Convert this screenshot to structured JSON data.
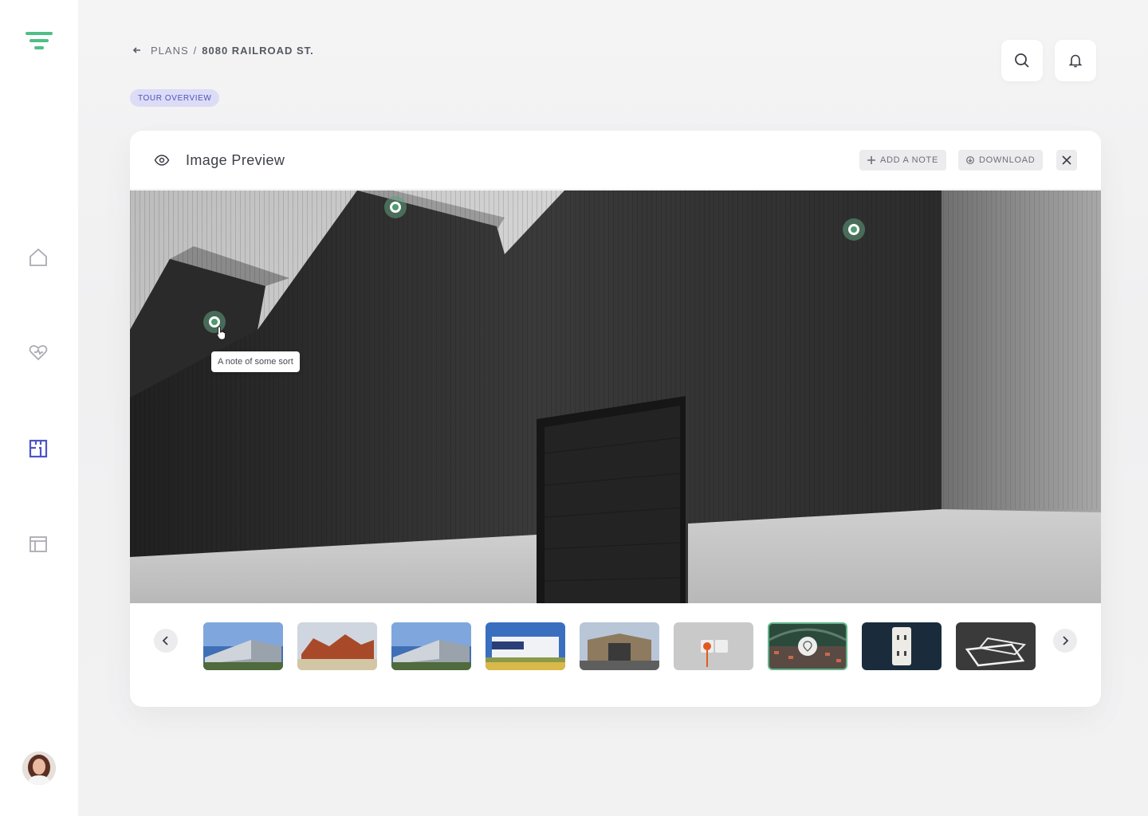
{
  "breadcrumb": {
    "parent": "PLANS",
    "separator": "/",
    "current": "8080 RAILROAD ST."
  },
  "tag": {
    "label": "TOUR OVERVIEW"
  },
  "card": {
    "title": "Image Preview",
    "add_note_label": "ADD A NOTE",
    "download_label": "DOWNLOAD"
  },
  "tooltip": {
    "text": "A note of some sort"
  },
  "sidebar": {
    "items": [
      {
        "name": "home",
        "icon": "home-icon",
        "active": false
      },
      {
        "name": "health",
        "icon": "heart-icon",
        "active": false
      },
      {
        "name": "plans",
        "icon": "floorplan-icon",
        "active": true
      },
      {
        "name": "table",
        "icon": "table-icon",
        "active": false
      }
    ]
  },
  "thumbnails": [
    {
      "name": "warehouse-1"
    },
    {
      "name": "red-buildings"
    },
    {
      "name": "warehouse-2"
    },
    {
      "name": "industrial-building"
    },
    {
      "name": "storefront"
    },
    {
      "name": "wall-outlet-orange"
    },
    {
      "name": "market-hall",
      "active": true
    },
    {
      "name": "wall-outlet-dark"
    },
    {
      "name": "ceiling-light"
    }
  ],
  "colors": {
    "accent": "#5fb58a",
    "nav_active": "#4d52c8",
    "tag_bg": "#dcdcf7",
    "tag_text": "#4d52b8"
  }
}
